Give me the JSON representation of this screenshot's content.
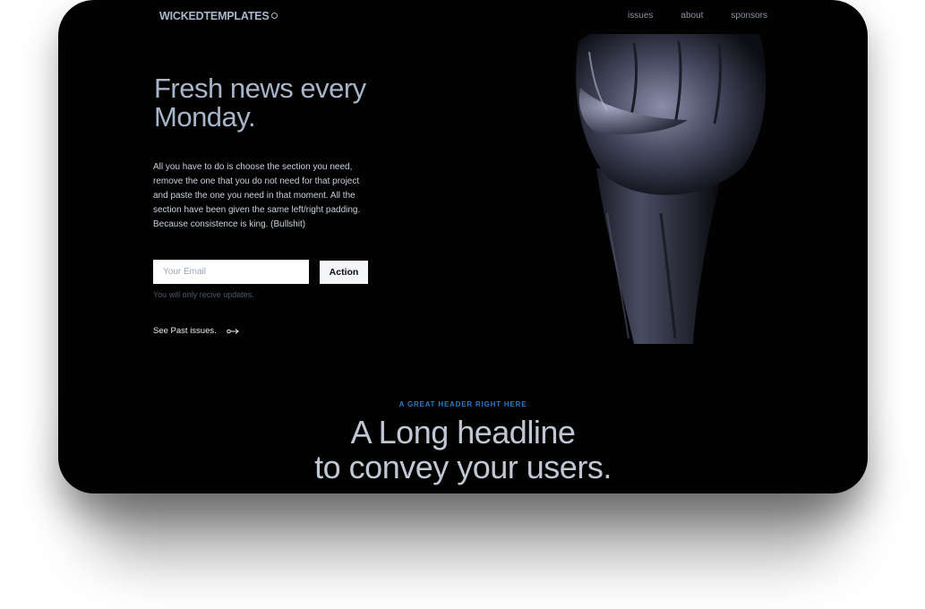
{
  "brand": {
    "name": "WICKEDTEMPLATES"
  },
  "nav": {
    "items": [
      {
        "label": "issues"
      },
      {
        "label": "about"
      },
      {
        "label": "sponsors"
      }
    ]
  },
  "hero": {
    "title": "Fresh news every Monday.",
    "body": "All you have to do is choose the section you need, remove the one that you do not need for that project and paste the one you need in that moment. All the section have been given the same left/right padding. Because consistence is king. (Bullshit)",
    "email_placeholder": "Your Email",
    "action_label": "Action",
    "hint": "You will only recive updates.",
    "past_link": "See Past issues."
  },
  "section": {
    "eyebrow": "A GREAT HEADER RIGHT HERE",
    "headline_line1": "A Long headline",
    "headline_line2": "to convey your users."
  },
  "colors": {
    "background": "#020203",
    "accent": "#2f78c4",
    "title": "#a8b4c8"
  },
  "icons": {
    "brand_mark": "circle-icon",
    "past_link": "arrow-right-icon",
    "hero_image": "fist-image"
  }
}
